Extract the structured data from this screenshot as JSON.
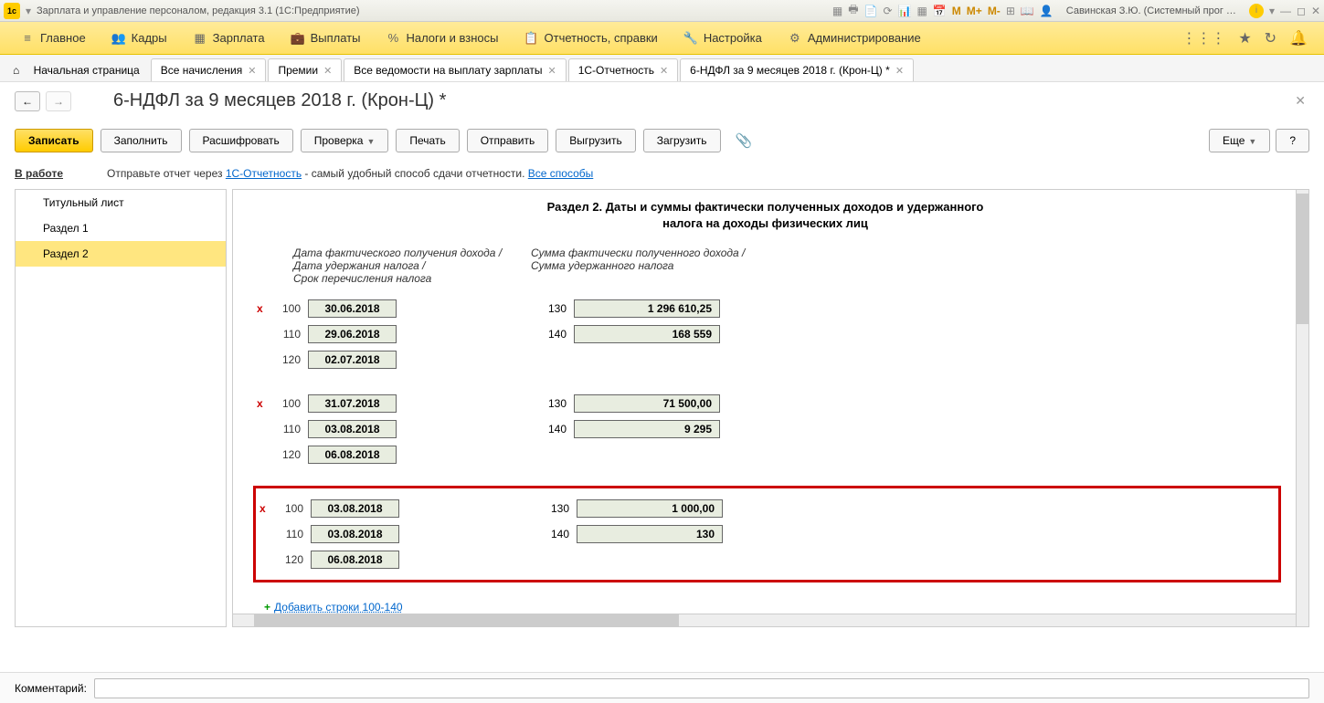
{
  "titlebar": {
    "title": "Зарплата и управление персоналом, редакция 3.1  (1С:Предприятие)",
    "user": "Савинская З.Ю. (Системный прог …",
    "m_icons": [
      "M",
      "M+",
      "M-"
    ]
  },
  "mainmenu": {
    "items": [
      {
        "icon": "★",
        "label": "Главное"
      },
      {
        "icon": "👥",
        "label": "Кадры"
      },
      {
        "icon": "▦",
        "label": "Зарплата"
      },
      {
        "icon": "💼",
        "label": "Выплаты"
      },
      {
        "icon": "%",
        "label": "Налоги и взносы"
      },
      {
        "icon": "📋",
        "label": "Отчетность, справки"
      },
      {
        "icon": "🔧",
        "label": "Настройка"
      },
      {
        "icon": "⚙",
        "label": "Администрирование"
      }
    ]
  },
  "tabs": {
    "home": "Начальная страница",
    "items": [
      "Все начисления",
      "Премии",
      "Все ведомости на выплату зарплаты",
      "1С-Отчетность",
      "6-НДФЛ за 9 месяцев 2018 г. (Крон-Ц) *"
    ],
    "active": 4
  },
  "doc": {
    "title": "6-НДФЛ за 9 месяцев 2018 г. (Крон-Ц) *"
  },
  "toolbar": {
    "save": "Записать",
    "fill": "Заполнить",
    "decode": "Расшифровать",
    "check": "Проверка",
    "print": "Печать",
    "send": "Отправить",
    "export": "Выгрузить",
    "import": "Загрузить",
    "more": "Еще",
    "help": "?"
  },
  "status": {
    "label": "В работе",
    "text1": "Отправьте отчет через ",
    "link1": "1С-Отчетность",
    "text2": " - самый удобный способ сдачи отчетности. ",
    "link2": "Все способы"
  },
  "sidebar": {
    "items": [
      "Титульный лист",
      "Раздел 1",
      "Раздел 2"
    ],
    "active": 2
  },
  "section": {
    "title": "Раздел 2.  Даты и суммы фактически полученных доходов и удержанного налога на доходы физических лиц",
    "header_left": "Дата фактического получения дохода / Дата удержания налога /\nСрок перечисления налога",
    "header_right": "Сумма фактически полученного дохода /\nСумма удержанного налога"
  },
  "blocks": [
    {
      "highlighted": false,
      "rows": [
        {
          "del": true,
          "c1": "100",
          "v1": "30.06.2018",
          "c2": "130",
          "v2": "1 296 610,25"
        },
        {
          "del": false,
          "c1": "110",
          "v1": "29.06.2018",
          "c2": "140",
          "v2": "168 559"
        },
        {
          "del": false,
          "c1": "120",
          "v1": "02.07.2018",
          "c2": "",
          "v2": ""
        }
      ]
    },
    {
      "highlighted": false,
      "rows": [
        {
          "del": true,
          "c1": "100",
          "v1": "31.07.2018",
          "c2": "130",
          "v2": "71 500,00"
        },
        {
          "del": false,
          "c1": "110",
          "v1": "03.08.2018",
          "c2": "140",
          "v2": "9 295"
        },
        {
          "del": false,
          "c1": "120",
          "v1": "06.08.2018",
          "c2": "",
          "v2": ""
        }
      ]
    },
    {
      "highlighted": true,
      "rows": [
        {
          "del": true,
          "c1": "100",
          "v1": "03.08.2018",
          "c2": "130",
          "v2": "1 000,00"
        },
        {
          "del": false,
          "c1": "110",
          "v1": "03.08.2018",
          "c2": "140",
          "v2": "130"
        },
        {
          "del": false,
          "c1": "120",
          "v1": "06.08.2018",
          "c2": "",
          "v2": ""
        }
      ]
    }
  ],
  "add_link": "Добавить строки 100-140",
  "footer": {
    "label": "Комментарий:"
  }
}
